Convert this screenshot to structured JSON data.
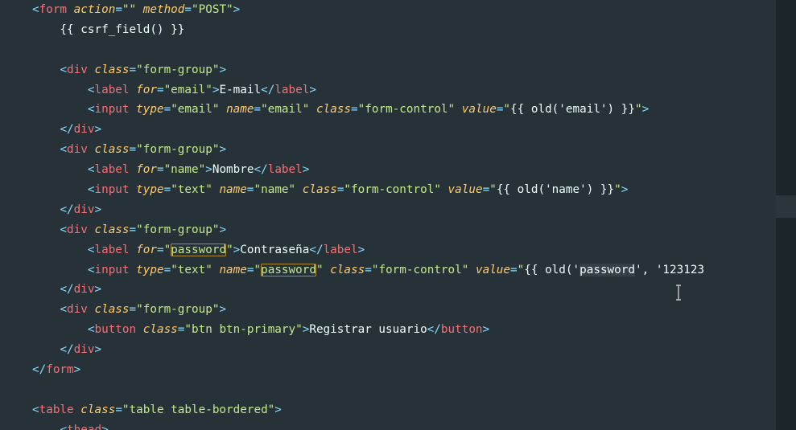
{
  "editor": {
    "code_lines": [
      [
        {
          "t": "<",
          "c": "punct"
        },
        {
          "t": "form",
          "c": "tag"
        },
        {
          "t": " ",
          "c": "text"
        },
        {
          "t": "action",
          "c": "attr"
        },
        {
          "t": "=",
          "c": "punct"
        },
        {
          "t": "\"\"",
          "c": "string"
        },
        {
          "t": " ",
          "c": "text"
        },
        {
          "t": "method",
          "c": "attr"
        },
        {
          "t": "=",
          "c": "punct"
        },
        {
          "t": "\"POST\"",
          "c": "string"
        },
        {
          "t": ">",
          "c": "punct"
        }
      ],
      [
        {
          "t": "    {{ csrf_field() }}",
          "c": "template"
        }
      ],
      [],
      [
        {
          "t": "    ",
          "c": "text"
        },
        {
          "t": "<",
          "c": "punct"
        },
        {
          "t": "div",
          "c": "tag"
        },
        {
          "t": " ",
          "c": "text"
        },
        {
          "t": "class",
          "c": "attr"
        },
        {
          "t": "=",
          "c": "punct"
        },
        {
          "t": "\"form-group\"",
          "c": "string"
        },
        {
          "t": ">",
          "c": "punct"
        }
      ],
      [
        {
          "t": "        ",
          "c": "text"
        },
        {
          "t": "<",
          "c": "punct"
        },
        {
          "t": "label",
          "c": "tag"
        },
        {
          "t": " ",
          "c": "text"
        },
        {
          "t": "for",
          "c": "attr"
        },
        {
          "t": "=",
          "c": "punct"
        },
        {
          "t": "\"email\"",
          "c": "string"
        },
        {
          "t": ">",
          "c": "punct"
        },
        {
          "t": "E-mail",
          "c": "text"
        },
        {
          "t": "</",
          "c": "punct"
        },
        {
          "t": "label",
          "c": "tag"
        },
        {
          "t": ">",
          "c": "punct"
        }
      ],
      [
        {
          "t": "        ",
          "c": "text"
        },
        {
          "t": "<",
          "c": "punct"
        },
        {
          "t": "input",
          "c": "tag"
        },
        {
          "t": " ",
          "c": "text"
        },
        {
          "t": "type",
          "c": "attr"
        },
        {
          "t": "=",
          "c": "punct"
        },
        {
          "t": "\"email\"",
          "c": "string"
        },
        {
          "t": " ",
          "c": "text"
        },
        {
          "t": "name",
          "c": "attr"
        },
        {
          "t": "=",
          "c": "punct"
        },
        {
          "t": "\"email\"",
          "c": "string"
        },
        {
          "t": " ",
          "c": "text"
        },
        {
          "t": "class",
          "c": "attr"
        },
        {
          "t": "=",
          "c": "punct"
        },
        {
          "t": "\"form-control\"",
          "c": "string"
        },
        {
          "t": " ",
          "c": "text"
        },
        {
          "t": "value",
          "c": "attr"
        },
        {
          "t": "=",
          "c": "punct"
        },
        {
          "t": "\"",
          "c": "string"
        },
        {
          "t": "{{ old('email') }}",
          "c": "template"
        },
        {
          "t": "\"",
          "c": "string"
        },
        {
          "t": ">",
          "c": "punct"
        }
      ],
      [
        {
          "t": "    ",
          "c": "text"
        },
        {
          "t": "</",
          "c": "punct"
        },
        {
          "t": "div",
          "c": "tag"
        },
        {
          "t": ">",
          "c": "punct"
        }
      ],
      [
        {
          "t": "    ",
          "c": "text"
        },
        {
          "t": "<",
          "c": "punct"
        },
        {
          "t": "div",
          "c": "tag"
        },
        {
          "t": " ",
          "c": "text"
        },
        {
          "t": "class",
          "c": "attr"
        },
        {
          "t": "=",
          "c": "punct"
        },
        {
          "t": "\"form-group\"",
          "c": "string"
        },
        {
          "t": ">",
          "c": "punct"
        }
      ],
      [
        {
          "t": "        ",
          "c": "text"
        },
        {
          "t": "<",
          "c": "punct"
        },
        {
          "t": "label",
          "c": "tag"
        },
        {
          "t": " ",
          "c": "text"
        },
        {
          "t": "for",
          "c": "attr"
        },
        {
          "t": "=",
          "c": "punct"
        },
        {
          "t": "\"name\"",
          "c": "string"
        },
        {
          "t": ">",
          "c": "punct"
        },
        {
          "t": "Nombre",
          "c": "text"
        },
        {
          "t": "</",
          "c": "punct"
        },
        {
          "t": "label",
          "c": "tag"
        },
        {
          "t": ">",
          "c": "punct"
        }
      ],
      [
        {
          "t": "        ",
          "c": "text"
        },
        {
          "t": "<",
          "c": "punct"
        },
        {
          "t": "input",
          "c": "tag"
        },
        {
          "t": " ",
          "c": "text"
        },
        {
          "t": "type",
          "c": "attr"
        },
        {
          "t": "=",
          "c": "punct"
        },
        {
          "t": "\"text\"",
          "c": "string"
        },
        {
          "t": " ",
          "c": "text"
        },
        {
          "t": "name",
          "c": "attr"
        },
        {
          "t": "=",
          "c": "punct"
        },
        {
          "t": "\"name\"",
          "c": "string"
        },
        {
          "t": " ",
          "c": "text"
        },
        {
          "t": "class",
          "c": "attr"
        },
        {
          "t": "=",
          "c": "punct"
        },
        {
          "t": "\"form-control\"",
          "c": "string"
        },
        {
          "t": " ",
          "c": "text"
        },
        {
          "t": "value",
          "c": "attr"
        },
        {
          "t": "=",
          "c": "punct"
        },
        {
          "t": "\"",
          "c": "string"
        },
        {
          "t": "{{ old('name') }}",
          "c": "template"
        },
        {
          "t": "\"",
          "c": "string"
        },
        {
          "t": ">",
          "c": "punct"
        }
      ],
      [
        {
          "t": "    ",
          "c": "text"
        },
        {
          "t": "</",
          "c": "punct"
        },
        {
          "t": "div",
          "c": "tag"
        },
        {
          "t": ">",
          "c": "punct"
        }
      ],
      [
        {
          "t": "    ",
          "c": "text"
        },
        {
          "t": "<",
          "c": "punct"
        },
        {
          "t": "div",
          "c": "tag"
        },
        {
          "t": " ",
          "c": "text"
        },
        {
          "t": "class",
          "c": "attr"
        },
        {
          "t": "=",
          "c": "punct"
        },
        {
          "t": "\"form-group\"",
          "c": "string"
        },
        {
          "t": ">",
          "c": "punct"
        }
      ],
      [
        {
          "t": "        ",
          "c": "text"
        },
        {
          "t": "<",
          "c": "punct"
        },
        {
          "t": "label",
          "c": "tag"
        },
        {
          "t": " ",
          "c": "text"
        },
        {
          "t": "for",
          "c": "attr"
        },
        {
          "t": "=",
          "c": "punct"
        },
        {
          "t": "\"",
          "c": "string"
        },
        {
          "t": "password",
          "c": "string",
          "hl": "box"
        },
        {
          "t": "\"",
          "c": "string"
        },
        {
          "t": ">",
          "c": "punct"
        },
        {
          "t": "Contraseña",
          "c": "text"
        },
        {
          "t": "</",
          "c": "punct"
        },
        {
          "t": "label",
          "c": "tag"
        },
        {
          "t": ">",
          "c": "punct"
        }
      ],
      [
        {
          "t": "        ",
          "c": "text"
        },
        {
          "t": "<",
          "c": "punct"
        },
        {
          "t": "input",
          "c": "tag"
        },
        {
          "t": " ",
          "c": "text"
        },
        {
          "t": "type",
          "c": "attr"
        },
        {
          "t": "=",
          "c": "punct"
        },
        {
          "t": "\"text\"",
          "c": "string"
        },
        {
          "t": " ",
          "c": "text"
        },
        {
          "t": "name",
          "c": "attr"
        },
        {
          "t": "=",
          "c": "punct"
        },
        {
          "t": "\"",
          "c": "string"
        },
        {
          "t": "password",
          "c": "string",
          "hl": "box"
        },
        {
          "t": "\"",
          "c": "string"
        },
        {
          "t": " ",
          "c": "text"
        },
        {
          "t": "class",
          "c": "attr"
        },
        {
          "t": "=",
          "c": "punct"
        },
        {
          "t": "\"form-control\"",
          "c": "string"
        },
        {
          "t": " ",
          "c": "text"
        },
        {
          "t": "value",
          "c": "attr"
        },
        {
          "t": "=",
          "c": "punct"
        },
        {
          "t": "\"",
          "c": "string"
        },
        {
          "t": "{{ old('",
          "c": "template"
        },
        {
          "t": "password",
          "c": "template",
          "hl": "soft"
        },
        {
          "t": "', '123123",
          "c": "template"
        }
      ],
      [
        {
          "t": "    ",
          "c": "text"
        },
        {
          "t": "</",
          "c": "punct"
        },
        {
          "t": "div",
          "c": "tag"
        },
        {
          "t": ">",
          "c": "punct"
        }
      ],
      [
        {
          "t": "    ",
          "c": "text"
        },
        {
          "t": "<",
          "c": "punct"
        },
        {
          "t": "div",
          "c": "tag"
        },
        {
          "t": " ",
          "c": "text"
        },
        {
          "t": "class",
          "c": "attr"
        },
        {
          "t": "=",
          "c": "punct"
        },
        {
          "t": "\"form-group\"",
          "c": "string"
        },
        {
          "t": ">",
          "c": "punct"
        }
      ],
      [
        {
          "t": "        ",
          "c": "text"
        },
        {
          "t": "<",
          "c": "punct"
        },
        {
          "t": "button",
          "c": "tag"
        },
        {
          "t": " ",
          "c": "text"
        },
        {
          "t": "class",
          "c": "attr"
        },
        {
          "t": "=",
          "c": "punct"
        },
        {
          "t": "\"btn btn-primary\"",
          "c": "string"
        },
        {
          "t": ">",
          "c": "punct"
        },
        {
          "t": "Registrar usuario",
          "c": "text"
        },
        {
          "t": "</",
          "c": "punct"
        },
        {
          "t": "button",
          "c": "tag"
        },
        {
          "t": ">",
          "c": "punct"
        }
      ],
      [
        {
          "t": "    ",
          "c": "text"
        },
        {
          "t": "</",
          "c": "punct"
        },
        {
          "t": "div",
          "c": "tag"
        },
        {
          "t": ">",
          "c": "punct"
        }
      ],
      [
        {
          "t": "</",
          "c": "punct"
        },
        {
          "t": "form",
          "c": "tag"
        },
        {
          "t": ">",
          "c": "punct"
        }
      ],
      [],
      [
        {
          "t": "<",
          "c": "punct"
        },
        {
          "t": "table",
          "c": "tag"
        },
        {
          "t": " ",
          "c": "text"
        },
        {
          "t": "class",
          "c": "attr"
        },
        {
          "t": "=",
          "c": "punct"
        },
        {
          "t": "\"table table-bordered\"",
          "c": "string"
        },
        {
          "t": ">",
          "c": "punct"
        }
      ],
      [
        {
          "t": "    ",
          "c": "text"
        },
        {
          "t": "<",
          "c": "punct"
        },
        {
          "t": "thead",
          "c": "tag"
        },
        {
          "t": ">",
          "c": "punct"
        }
      ]
    ]
  }
}
